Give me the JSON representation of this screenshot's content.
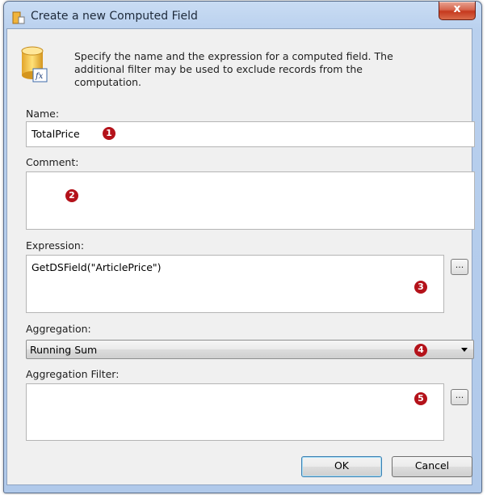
{
  "window": {
    "title": "Create a new Computed Field",
    "close_label": "x"
  },
  "header": {
    "description": "Specify the name and the expression for a computed field. The additional filter may be used to exclude records from the computation."
  },
  "name": {
    "label": "Name:",
    "value": "TotalPrice"
  },
  "comment": {
    "label": "Comment:",
    "value": ""
  },
  "expression": {
    "label": "Expression:",
    "value": "GetDSField(\"ArticlePrice\")",
    "browse_label": "..."
  },
  "aggregation": {
    "label": "Aggregation:",
    "selected": "Running Sum"
  },
  "aggregation_filter": {
    "label": "Aggregation Filter:",
    "value": "",
    "browse_label": "..."
  },
  "markers": [
    "1",
    "2",
    "3",
    "4",
    "5"
  ],
  "buttons": {
    "ok": "OK",
    "cancel": "Cancel"
  },
  "colors": {
    "marker": "#b4121a",
    "title_bar": "#b9d0ee",
    "dialog_bg": "#f0f0f0"
  }
}
